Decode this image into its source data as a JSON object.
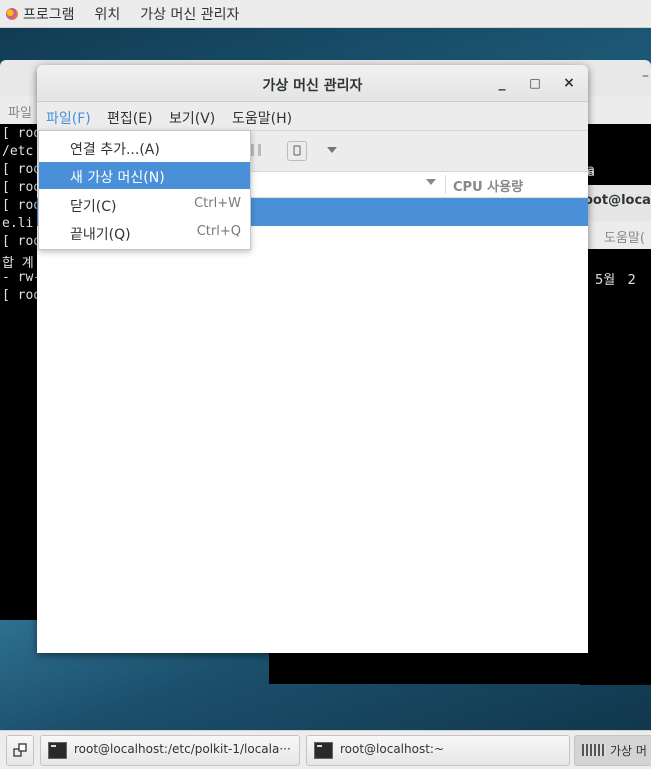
{
  "top_panel": {
    "applications": "프로그램",
    "places": "위치",
    "active_app": "가상 머신 관리자"
  },
  "bg_window": {
    "menu_partial": "파일"
  },
  "terminal_lines": [
    "[ roo",
    "/etc",
    "[ roo",
    "[ roo",
    "[ roo",
    "e.li",
    "[ roo",
    "합 계",
    "- rw-",
    "[ roo"
  ],
  "right_terminal": {
    "title_partial": "oot@local",
    "menu_partial": "도움말(",
    "line_a": "a",
    "line_date": "5월   2"
  },
  "main_window": {
    "title": "가상 머신 관리자",
    "minimize": "_",
    "maximize": "□",
    "close": "×",
    "menu": [
      "파일(F)",
      "편집(E)",
      "보기(V)",
      "도움말(H)"
    ],
    "column_cpu": "CPU 사용량"
  },
  "file_menu": [
    {
      "label": "연결 추가...(A)",
      "shortcut": ""
    },
    {
      "label": "새 가상 머신(N)",
      "shortcut": ""
    },
    {
      "label": "닫기(C)",
      "shortcut": "Ctrl+W"
    },
    {
      "label": "끝내기(Q)",
      "shortcut": "Ctrl+Q"
    }
  ],
  "taskbar": [
    {
      "label": "root@localhost:/etc/polkit-1/locala···"
    },
    {
      "label": "root@localhost:~"
    },
    {
      "label": "가상 머"
    }
  ]
}
